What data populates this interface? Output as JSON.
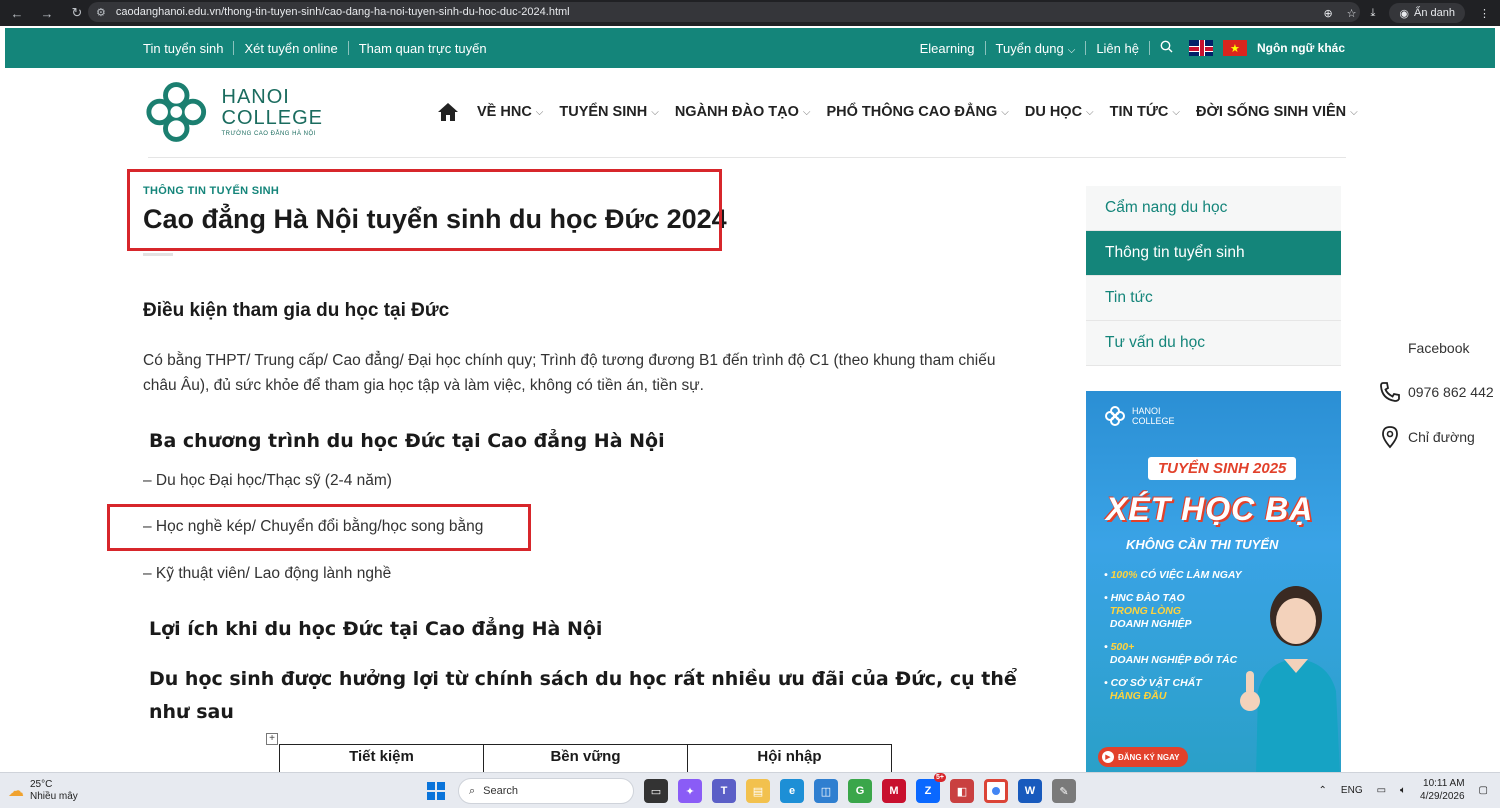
{
  "browser": {
    "url": "caodanghanoi.edu.vn/thong-tin-tuyen-sinh/cao-dang-ha-noi-tuyen-sinh-du-hoc-duc-2024.html",
    "incognito_label": "Ẩn danh"
  },
  "topbar": {
    "left_links": [
      "Tin tuyển sinh",
      "Xét tuyển online",
      "Tham quan trực tuyến"
    ],
    "right_links": [
      "Elearning",
      "Tuyển dụng",
      "Liên hệ"
    ],
    "language_label": "Ngôn ngữ khác",
    "color": "#14857a"
  },
  "logo": {
    "line1": "HANOI",
    "line2": "COLLEGE",
    "line3": "TRƯỜNG CAO ĐẲNG HÀ NỘI"
  },
  "main_nav": [
    "VỀ HNC",
    "TUYỂN SINH",
    "NGÀNH ĐÀO TẠO",
    "PHỔ THÔNG CAO ĐẲNG",
    "DU HỌC",
    "TIN TỨC",
    "ĐỜI SỐNG SINH VIÊN"
  ],
  "article": {
    "category": "THÔNG TIN TUYỂN SINH",
    "title": "Cao đẳng Hà Nội tuyển sinh du học Đức 2024",
    "section1_heading": "Điều kiện tham gia du học tại Đức",
    "section1_para": "Có bằng THPT/ Trung cấp/ Cao đẳng/ Đại học chính quy; Trình độ tương đương B1 đến trình độ C1 (theo khung tham chiếu châu Âu), đủ sức khỏe để tham gia học tập và làm việc, không có tiền án, tiền sự.",
    "section2_heading": "Ba chương trình du học Đức tại Cao đẳng Hà Nội",
    "programs": [
      "– Du học Đại học/Thạc sỹ (2-4 năm)",
      "– Học nghề kép/ Chuyển đổi bằng/học song bằng",
      "– Kỹ thuật viên/ Lao động lành nghề"
    ],
    "section3_heading": "Lợi ích khi du học Đức tại Cao đẳng Hà Nội",
    "section4_heading": "Du học sinh được hưởng lợi từ chính sách du học rất nhiều ưu đãi của Đức, cụ thể như sau",
    "table_headers": [
      "Tiết kiệm",
      "Bền vững",
      "Hội nhập"
    ]
  },
  "sidebar": {
    "items": [
      "Cẩm nang du học",
      "Thông tin tuyển sinh",
      "Tin tức",
      "Tư vấn du học"
    ],
    "active_index": 1
  },
  "banner": {
    "logo_line1": "HANOI",
    "logo_line2": "COLLEGE",
    "tag": "TUYỂN SINH 2025",
    "headline": "XÉT HỌC BẠ",
    "subline": "KHÔNG CẦN THI TUYỂN",
    "bullet1_hl": "100%",
    "bullet1": " CÓ VIỆC LÀM NGAY",
    "bullet2": "HNC ĐÀO TẠO",
    "bullet2_hl": "TRONG LÒNG",
    "bullet2_tail": "DOANH NGHIỆP",
    "bullet3_hl": "500+",
    "bullet3": "DOANH NGHIỆP ĐỐI TÁC",
    "bullet4": "CƠ SỞ VẬT CHẤT",
    "bullet4_hl": "HÀNG ĐẦU",
    "cta": "ĐĂNG KÝ NGAY"
  },
  "floating": {
    "facebook": "Facebook",
    "phone": "0976 862 442",
    "directions": "Chỉ đường"
  },
  "taskbar": {
    "temp": "25°C",
    "weather": "Nhiều mây",
    "search": "Search",
    "lang": "ENG",
    "time": "10:11 AM",
    "date": "4/29/2026",
    "badge": "5+"
  }
}
